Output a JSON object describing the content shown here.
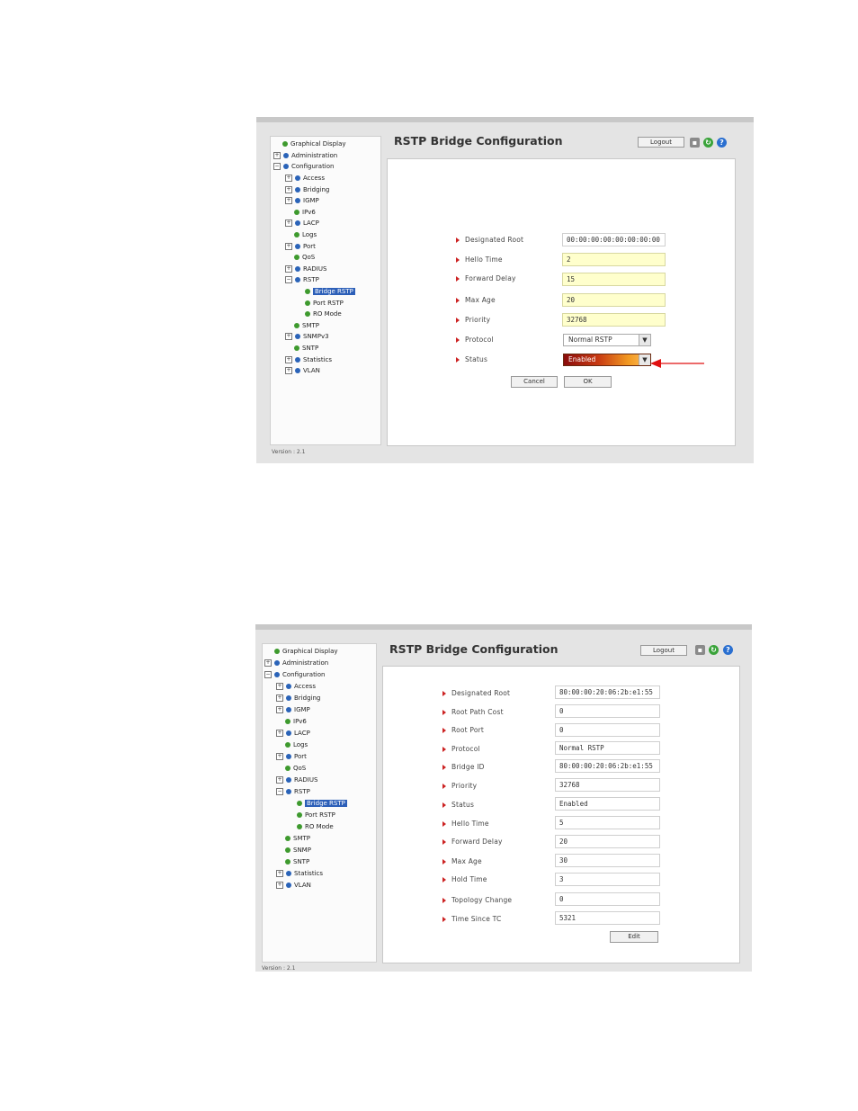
{
  "shot1": {
    "sidebar": {
      "items": [
        {
          "label": "Graphical Display"
        },
        {
          "label": "Administration"
        },
        {
          "label": "Configuration"
        },
        {
          "label": "Access"
        },
        {
          "label": "Bridging"
        },
        {
          "label": "IGMP"
        },
        {
          "label": "IPv6"
        },
        {
          "label": "LACP"
        },
        {
          "label": "Logs"
        },
        {
          "label": "Port"
        },
        {
          "label": "QoS"
        },
        {
          "label": "RADIUS"
        },
        {
          "label": "RSTP"
        },
        {
          "label": "Bridge RSTP"
        },
        {
          "label": "Port RSTP"
        },
        {
          "label": "RO Mode"
        },
        {
          "label": "SMTP"
        },
        {
          "label": "SNMPv3"
        },
        {
          "label": "SNTP"
        },
        {
          "label": "Statistics"
        },
        {
          "label": "VLAN"
        }
      ],
      "version": "Version : 2.1"
    },
    "header": {
      "title": "RSTP Bridge Configuration",
      "logout_label": "Logout"
    },
    "form": {
      "designated_root": {
        "label": "Designated Root",
        "value": "00:00:00:00:00:00:00:00"
      },
      "hello_time": {
        "label": "Hello Time",
        "value": "2"
      },
      "forward_delay": {
        "label": "Forward Delay",
        "value": "15"
      },
      "max_age": {
        "label": "Max Age",
        "value": "20"
      },
      "priority": {
        "label": "Priority",
        "value": "32768"
      },
      "protocol": {
        "label": "Protocol",
        "value": "Normal RSTP"
      },
      "status": {
        "label": "Status",
        "value": "Enabled"
      },
      "cancel_label": "Cancel",
      "ok_label": "OK"
    },
    "annotation_color": "#e01010"
  },
  "shot2": {
    "sidebar": {
      "items": [
        {
          "label": "Graphical Display"
        },
        {
          "label": "Administration"
        },
        {
          "label": "Configuration"
        },
        {
          "label": "Access"
        },
        {
          "label": "Bridging"
        },
        {
          "label": "IGMP"
        },
        {
          "label": "IPv6"
        },
        {
          "label": "LACP"
        },
        {
          "label": "Logs"
        },
        {
          "label": "Port"
        },
        {
          "label": "QoS"
        },
        {
          "label": "RADIUS"
        },
        {
          "label": "RSTP"
        },
        {
          "label": "Bridge RSTP"
        },
        {
          "label": "Port RSTP"
        },
        {
          "label": "RO Mode"
        },
        {
          "label": "SMTP"
        },
        {
          "label": "SNMP"
        },
        {
          "label": "SNTP"
        },
        {
          "label": "Statistics"
        },
        {
          "label": "VLAN"
        }
      ],
      "version": "Version : 2.1"
    },
    "header": {
      "title": "RSTP Bridge Configuration",
      "logout_label": "Logout"
    },
    "rows": [
      {
        "label": "Designated Root",
        "value": "80:00:00:20:06:2b:e1:55"
      },
      {
        "label": "Root Path Cost",
        "value": "0"
      },
      {
        "label": "Root Port",
        "value": "0"
      },
      {
        "label": "Protocol",
        "value": "Normal RSTP"
      },
      {
        "label": "Bridge ID",
        "value": "80:00:00:20:06:2b:e1:55"
      },
      {
        "label": "Priority",
        "value": "32768"
      },
      {
        "label": "Status",
        "value": "Enabled"
      },
      {
        "label": "Hello Time",
        "value": "5"
      },
      {
        "label": "Forward Delay",
        "value": "20"
      },
      {
        "label": "Max Age",
        "value": "30"
      },
      {
        "label": "Hold Time",
        "value": "3"
      },
      {
        "label": "Topology Change",
        "value": "0"
      },
      {
        "label": "Time Since TC",
        "value": "5321"
      }
    ],
    "edit_label": "Edit"
  }
}
